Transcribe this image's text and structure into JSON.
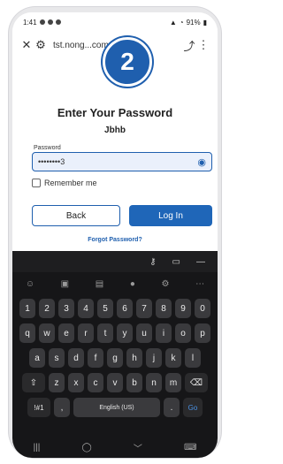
{
  "status": {
    "time": "1:41",
    "battery": "91%"
  },
  "browser": {
    "url": "tst.nong...com"
  },
  "badge": {
    "number": "2"
  },
  "form": {
    "title": "Enter Your Password",
    "username": "Jbhb",
    "password_label": "Password",
    "password_value": "••••••••3",
    "remember_label": "Remember me",
    "back_label": "Back",
    "login_label": "Log In",
    "forgot_label": "Forgot Password?"
  },
  "keyboard": {
    "row1": [
      "1",
      "2",
      "3",
      "4",
      "5",
      "6",
      "7",
      "8",
      "9",
      "0"
    ],
    "row2": [
      "q",
      "w",
      "e",
      "r",
      "t",
      "y",
      "u",
      "i",
      "o",
      "p"
    ],
    "row3": [
      "a",
      "s",
      "d",
      "f",
      "g",
      "h",
      "j",
      "k",
      "l"
    ],
    "row4": [
      "z",
      "x",
      "c",
      "v",
      "b",
      "n",
      "m"
    ],
    "symbols": "!#1",
    "comma": ",",
    "space": "English (US)",
    "period": ".",
    "go": "Go"
  },
  "colors": {
    "accent": "#1f5fae",
    "keyboard_bg": "#161618",
    "key_bg": "#3a3a3d"
  }
}
